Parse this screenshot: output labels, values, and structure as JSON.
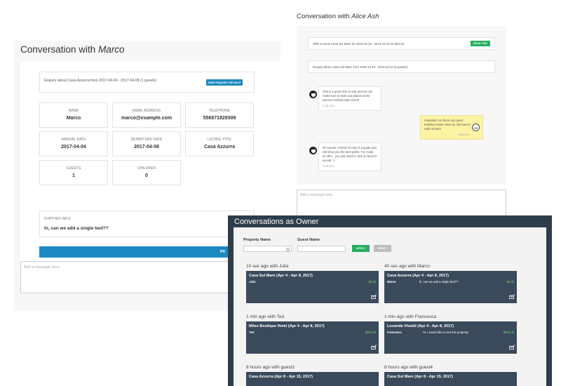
{
  "marco": {
    "title_prefix": "Conversation with ",
    "title_name": "Marco",
    "enquiry_text": "Enquiry about Casa Azzurra from 2017-04-04 - 2017-04-08 (1 guests)",
    "hide_button": "HIDE ENQUIRY DETAILS",
    "fields": [
      {
        "label": "NAME",
        "value": "Marco"
      },
      {
        "label": "EMAIL ADDRESS",
        "value": "marco@example.com"
      },
      {
        "label": "TELEPHONE",
        "value": "556671829309"
      },
      {
        "label": "ARRIVAL DATE",
        "value": "2017-04-04"
      },
      {
        "label": "DEPARTURE DATE",
        "value": "2017-04-08"
      },
      {
        "label": "LISTING TYPE",
        "value": "Casa Azzurra"
      },
      {
        "label": "GUESTS",
        "value": "1"
      },
      {
        "label": "CHILDREN",
        "value": "0"
      }
    ],
    "further_label": "FURTHER INFO:",
    "further_value": "hi, can we add a single bed??",
    "wide_button": "PR",
    "message_placeholder": "Add a message here."
  },
  "alice": {
    "title_prefix": "Conversation with ",
    "title_name": "Alice Ash",
    "offer_text": "Offer to book Casa Sul Mare for 2016-10-18 - 2016-10-24 for $20.00",
    "book_button": "BOOK THIS",
    "enquiry_text": "Enquiry about Casa Sul Mare from 2016-10-18 - 2016-10-24 (6 guests)",
    "messages": [
      {
        "text": "This is a great time to visit and we can make sure to book you places at the summer festival main event!",
        "time": "12.08.2016"
      },
      {
        "text": "Fantastic! Are there any great trekking routes close by. We love to walk around!",
        "time": "12.08.2016"
      },
      {
        "text": "Of course! A friend of mine is a guide and will show you the best paths. I've made an offer - you just need to click on book to accept :-)",
        "time": "12.08.2016"
      }
    ],
    "message_placeholder": "Add a message here."
  },
  "owner": {
    "title": "Conversations as Owner",
    "property_label": "Property Name",
    "guest_label": "Guest Name",
    "apply_button": "APPLY",
    "reset_button": "RESET",
    "groups": [
      {
        "heading": "10 sec ago with Julia",
        "property": "Casa Sul Mare (Apr 4 - Apr 8, 2017)",
        "guest": "Julia",
        "message": "",
        "price": "$0.00"
      },
      {
        "heading": "40 sec ago with Marco",
        "property": "Casa Azzurra (Apr 4 - Apr 8, 2017)",
        "guest": "Marco",
        "message": "hi, can we add a single bed??",
        "price": "$0.00"
      },
      {
        "heading": "1 min ago with Ted",
        "property": "Miles Boutique Hotel (Apr 4 - Apr 8, 2017)",
        "guest": "Ted",
        "message": "",
        "price": "$300.00"
      },
      {
        "heading": "1 min ago with Francesca",
        "property": "Locanda Vivaldi (Apr 4 - Apr 8, 2017)",
        "guest": "Francesca",
        "message": "Hi, I would like to rent this property!",
        "price": "$600.00"
      },
      {
        "heading": "8 hours ago with guest3",
        "property": "Casa Azzurra (Apr 8 - Apr 15, 2017)"
      },
      {
        "heading": "8 hours ago with guest4",
        "property": "Casa Sul Mare (Apr 8 - Apr 15, 2017)"
      }
    ]
  }
}
